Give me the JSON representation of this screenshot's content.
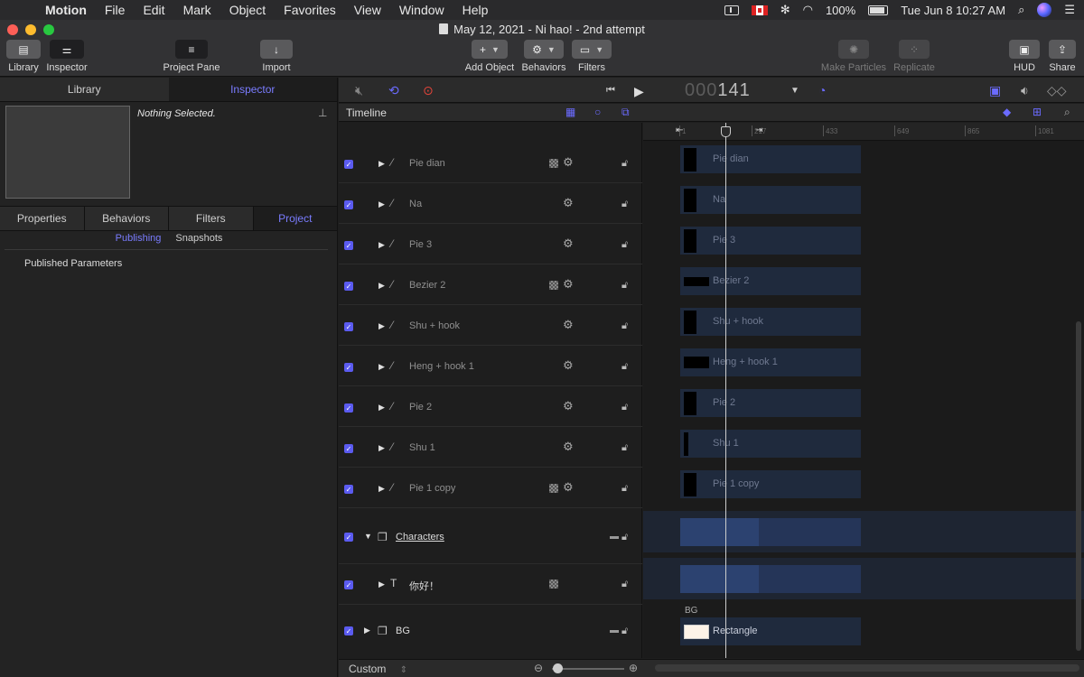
{
  "menubar": {
    "app": "Motion",
    "items": [
      "File",
      "Edit",
      "Mark",
      "Object",
      "Favorites",
      "View",
      "Window",
      "Help"
    ],
    "battery": "100%",
    "clock": "Tue Jun 8  10:27 AM"
  },
  "window": {
    "title": "May 12, 2021 - Ni hao! - 2nd attempt"
  },
  "toolbar": {
    "library": "Library",
    "inspector": "Inspector",
    "project_pane": "Project Pane",
    "import": "Import",
    "add_object": "Add Object",
    "behaviors": "Behaviors",
    "filters": "Filters",
    "make_particles": "Make Particles",
    "replicate": "Replicate",
    "hud": "HUD",
    "share": "Share"
  },
  "left_panel": {
    "tabs": [
      "Library",
      "Inspector"
    ],
    "nothing_selected": "Nothing Selected.",
    "inspector_tabs": [
      "Properties",
      "Behaviors",
      "Filters",
      "Project"
    ],
    "subtabs": [
      "Publishing",
      "Snapshots"
    ],
    "published_parameters": "Published Parameters"
  },
  "canvas_toolbar": {
    "timecode_dim": "000",
    "timecode": "141"
  },
  "timeline": {
    "label": "Timeline",
    "ruler_ticks": [
      "1",
      "217",
      "433",
      "649",
      "865",
      "1081"
    ],
    "layers": [
      {
        "name": "Pie dian",
        "checker": true
      },
      {
        "name": "Na",
        "checker": false
      },
      {
        "name": "Pie 3",
        "checker": false
      },
      {
        "name": "Bezier 2",
        "checker": true
      },
      {
        "name": "Shu + hook",
        "checker": false
      },
      {
        "name": "Heng + hook 1",
        "checker": false
      },
      {
        "name": "Pie 2",
        "checker": false
      },
      {
        "name": "Shu 1",
        "checker": false
      },
      {
        "name": "Pie 1 copy",
        "checker": true
      }
    ],
    "group_characters": "Characters",
    "text_layer": "你好！",
    "group_bg": "BG",
    "bg_label": "BG",
    "rectangle": "Rectangle",
    "zoom_preset": "Custom"
  },
  "colors": {
    "accent": "#7a7cff",
    "checkbox": "#5b5bf0",
    "track": "#1f2a3d"
  }
}
